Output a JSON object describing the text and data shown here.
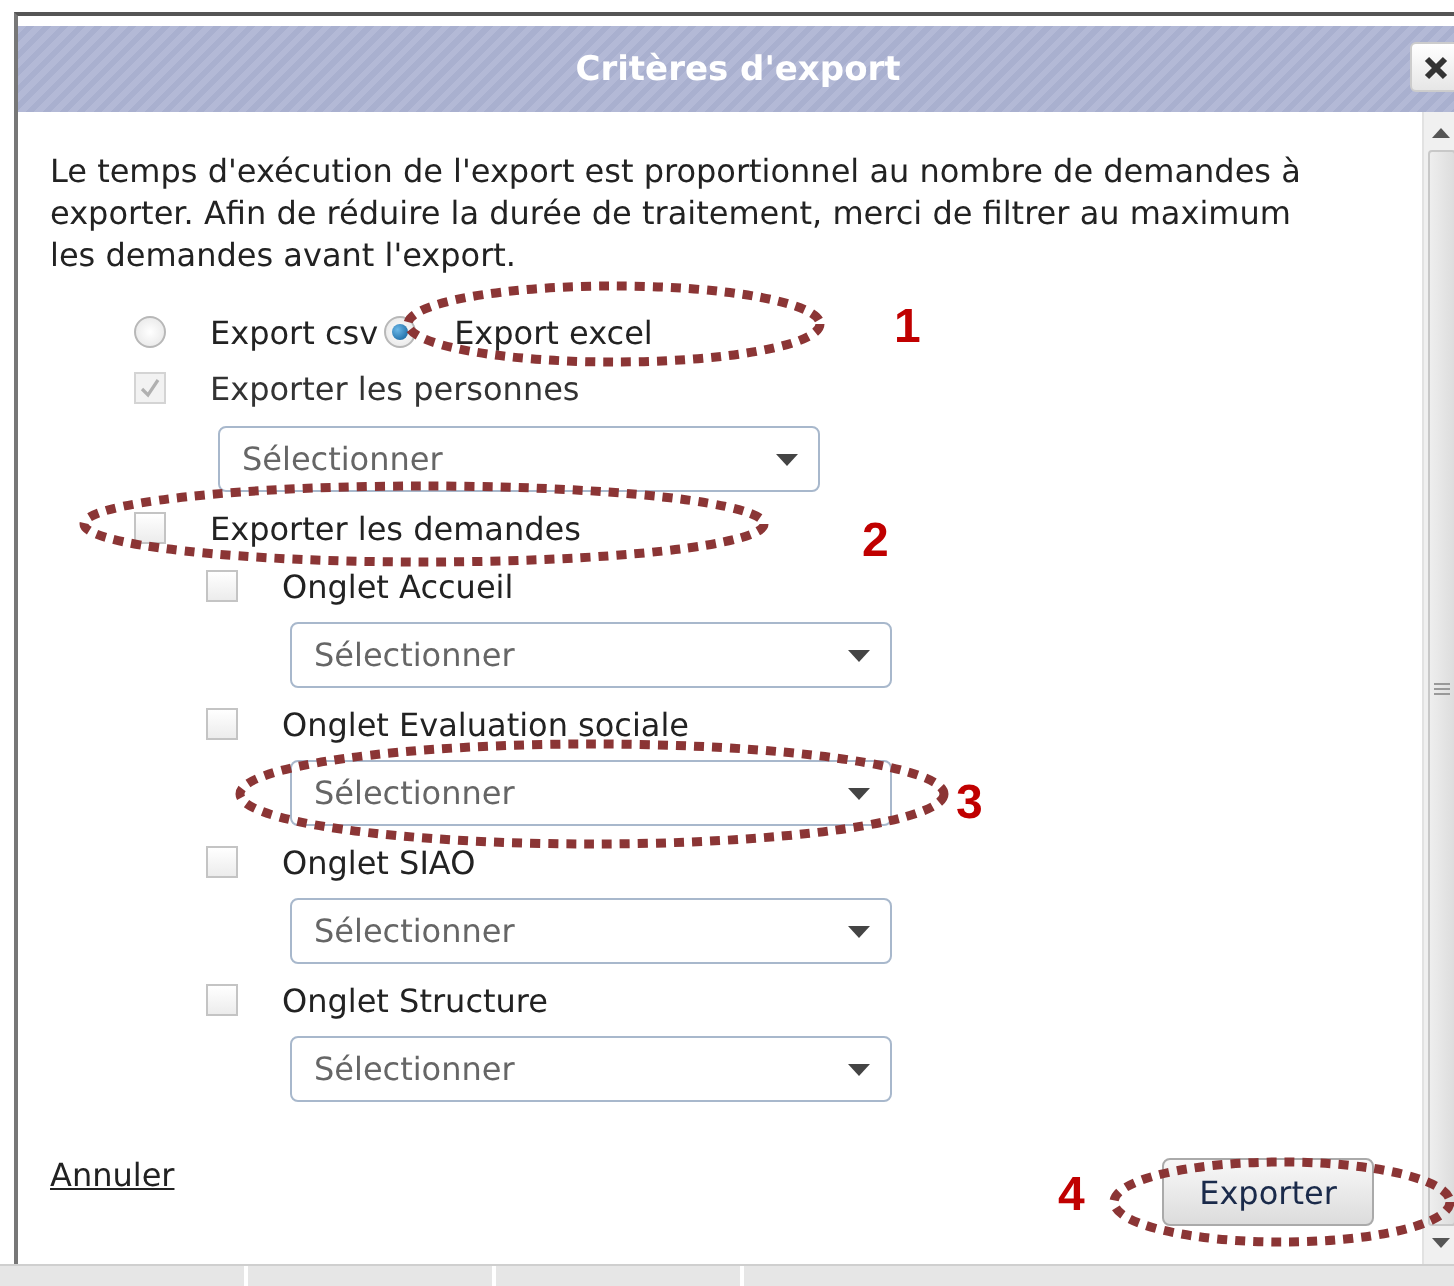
{
  "window": {
    "title": "Critères d'export"
  },
  "intro": "Le temps d'exécution de l'export est proportionnel au nombre de demandes à exporter. Afin de réduire la durée de traitement, merci de filtrer au maximum les demandes avant l'export.",
  "format_options": [
    {
      "label": "Export csv",
      "selected": false
    },
    {
      "label": "Export excel",
      "selected": true
    }
  ],
  "persons": {
    "label": "Exporter les personnes",
    "checked": true,
    "disabled": true,
    "placeholder": "Sélectionner"
  },
  "requests": {
    "label": "Exporter les demandes",
    "checked": false,
    "tabs": [
      {
        "label": "Onglet Accueil",
        "checked": false,
        "placeholder": "Sélectionner"
      },
      {
        "label": "Onglet Evaluation sociale",
        "checked": false,
        "placeholder": "Sélectionner"
      },
      {
        "label": "Onglet SIAO",
        "checked": false,
        "placeholder": "Sélectionner"
      },
      {
        "label": "Onglet Structure",
        "checked": false,
        "placeholder": "Sélectionner"
      }
    ]
  },
  "actions": {
    "cancel": "Annuler",
    "export": "Exporter"
  },
  "annotations": [
    {
      "label": "1"
    },
    {
      "label": "2"
    },
    {
      "label": "3"
    },
    {
      "label": "4"
    }
  ]
}
